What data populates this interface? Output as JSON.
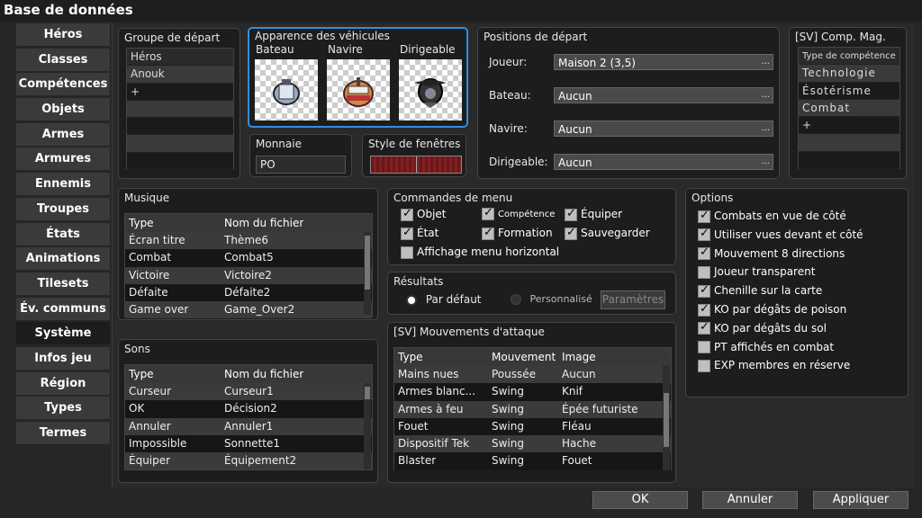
{
  "window": {
    "title": "Base de données"
  },
  "nav": [
    "Héros",
    "Classes",
    "Compétences",
    "Objets",
    "Armes",
    "Armures",
    "Ennemis",
    "Troupes",
    "États",
    "Animations",
    "Tilesets",
    "Év. communs",
    "Système",
    "Infos jeu",
    "Région",
    "Types",
    "Termes"
  ],
  "starting_party": {
    "title": "Groupe de départ",
    "header": "Héros",
    "items": [
      "Anouk",
      "+"
    ]
  },
  "vehicles": {
    "title": "Apparence des véhicules",
    "labels": [
      "Bateau",
      "Navire",
      "Dirigeable"
    ]
  },
  "currency": {
    "title": "Monnaie",
    "value": "PO"
  },
  "window_style": {
    "title": "Style de fenêtres"
  },
  "positions": {
    "title": "Positions de départ",
    "rows": [
      {
        "label": "Joueur:",
        "value": "Maison 2  (3,5)"
      },
      {
        "label": "Bateau:",
        "value": "Aucun"
      },
      {
        "label": "Navire:",
        "value": "Aucun"
      },
      {
        "label": "Dirigeable:",
        "value": "Aucun"
      }
    ],
    "ellipsis": "..."
  },
  "magic_skills": {
    "title": "[SV] Comp. Mag.",
    "header": "Type de compétence",
    "items": [
      "Technologie",
      "Ésotérisme",
      "Combat",
      "+"
    ]
  },
  "music": {
    "title": "Musique",
    "headers": [
      "Type",
      "Nom du fichier"
    ],
    "rows": [
      [
        "Écran titre",
        "Thème6"
      ],
      [
        "Combat",
        "Combat5"
      ],
      [
        "Victoire",
        "Victoire2"
      ],
      [
        "Défaite",
        "Défaite2"
      ],
      [
        "Game over",
        "Game_Over2"
      ]
    ]
  },
  "sounds": {
    "title": "Sons",
    "headers": [
      "Type",
      "Nom du fichier"
    ],
    "rows": [
      [
        "Curseur",
        "Curseur1"
      ],
      [
        "OK",
        "Décision2"
      ],
      [
        "Annuler",
        "Annuler1"
      ],
      [
        "Impossible",
        "Sonnette1"
      ],
      [
        "Équiper",
        "Équipement2"
      ]
    ]
  },
  "menu_commands": {
    "title": "Commandes de menu",
    "items": [
      {
        "label": "Objet",
        "checked": true
      },
      {
        "label": "Compétence",
        "checked": true
      },
      {
        "label": "Équiper",
        "checked": true
      },
      {
        "label": "État",
        "checked": true
      },
      {
        "label": "Formation",
        "checked": true
      },
      {
        "label": "Sauvegarder",
        "checked": true
      },
      {
        "label": "Affichage menu horizontal",
        "checked": false
      }
    ]
  },
  "results": {
    "title": "Résultats",
    "default": "Par défaut",
    "custom": "Personnalisé",
    "params": "Paramètres"
  },
  "attack_motions": {
    "title": "[SV] Mouvements d'attaque",
    "headers": [
      "Type",
      "Mouvement",
      "Image"
    ],
    "rows": [
      [
        "Mains nues",
        "Poussée",
        "Aucun"
      ],
      [
        "Armes blanc...",
        "Swing",
        "Knif"
      ],
      [
        "Armes à feu",
        "Swing",
        "Épée futuriste"
      ],
      [
        "Fouet",
        "Swing",
        "Fléau"
      ],
      [
        "Dispositif Tek",
        "Swing",
        "Hache"
      ],
      [
        "Blaster",
        "Swing",
        "Fouet"
      ]
    ]
  },
  "options": {
    "title": "Options",
    "items": [
      {
        "label": "Combats en vue de côté",
        "checked": true
      },
      {
        "label": "Utiliser vues devant et côté",
        "checked": true
      },
      {
        "label": "Mouvement 8 directions",
        "checked": true
      },
      {
        "label": "Joueur transparent",
        "checked": false
      },
      {
        "label": "Chenille sur la carte",
        "checked": true
      },
      {
        "label": "KO par dégâts de poison",
        "checked": true
      },
      {
        "label": "KO par dégâts du sol",
        "checked": true
      },
      {
        "label": "PT affichés en combat",
        "checked": false
      },
      {
        "label": "EXP membres en réserve",
        "checked": false
      }
    ]
  },
  "buttons": {
    "ok": "OK",
    "cancel": "Annuler",
    "apply": "Appliquer"
  },
  "colors": {
    "accent": "#2f8fe0",
    "window_style": "#7a1a1a"
  }
}
